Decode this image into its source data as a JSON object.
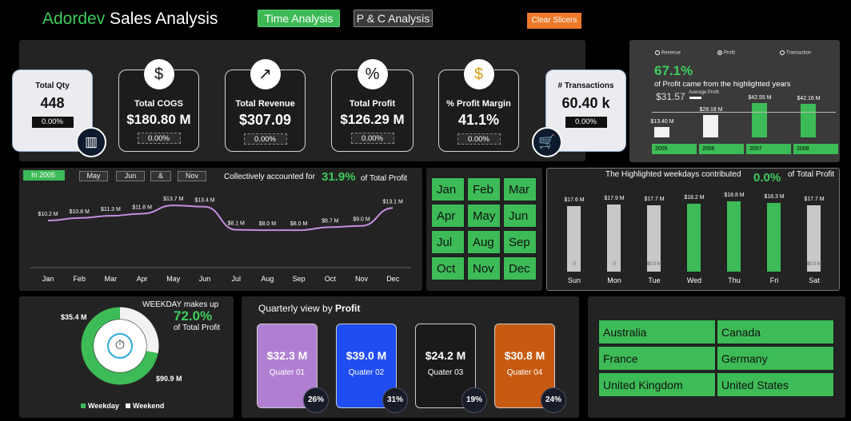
{
  "header": {
    "brand": "Adordev",
    "title": " Sales Analysis",
    "nav_time": "Time Analysis",
    "nav_pc": "P & C Analysis",
    "clear": "Clear Slicers"
  },
  "kpis": {
    "qty": {
      "label": "Total Qty",
      "value": "448",
      "pct": "0.00%"
    },
    "cogs": {
      "label": "Total COGS",
      "value": "$180.80 M",
      "pct": "0.00%"
    },
    "revenue": {
      "label": "Total Revenue",
      "value": "$307.09",
      "pct": "0.00%"
    },
    "profit": {
      "label": "Total Profit",
      "value": "$126.29 M",
      "pct": "0.00%"
    },
    "margin": {
      "label": "% Profit Margin",
      "value": "41.1%",
      "pct": "0.00%"
    },
    "transactions": {
      "label": "# Transactions",
      "value": "60.40 k",
      "pct": "0.00%"
    }
  },
  "yearly": {
    "options": [
      "Revenue",
      "Profit",
      "Transaction"
    ],
    "selected": "Profit",
    "headline": "67.1%",
    "subtitle": "of Profit came from the highlighted years",
    "avg_value": "$31.57",
    "avg_label": "Average Profit",
    "colors": {
      "highlight": "#3dbb57",
      "normal": "#f2f2f2"
    },
    "chart_data": {
      "type": "bar",
      "categories": [
        "2005",
        "2006",
        "2007",
        "2008"
      ],
      "values": [
        13.4,
        28.18,
        42.55,
        42.16
      ],
      "labels": [
        "$13.40 M",
        "$28.18 M",
        "$42.55 M",
        "$42.16 M"
      ],
      "highlighted": [
        false,
        false,
        true,
        true
      ],
      "reference_line": 31.57
    }
  },
  "monthly": {
    "year_chip": "In 2005",
    "chips": [
      "May",
      "Jun",
      "&",
      "Nov"
    ],
    "text_pre": "Collectively accounted for",
    "pct": "31.9%",
    "text_post": "of Total Profit",
    "chart_data": {
      "type": "line",
      "categories": [
        "Jan",
        "Feb",
        "Mar",
        "Apr",
        "May",
        "Jun",
        "Jul",
        "Aug",
        "Sep",
        "Oct",
        "Nov",
        "Dec"
      ],
      "values": [
        10.2,
        10.8,
        11.3,
        11.8,
        13.7,
        13.4,
        8.1,
        8.0,
        8.0,
        8.7,
        9.0,
        13.1
      ],
      "labels": [
        "$10.2 M",
        "$10.8 M",
        "$11.3 M",
        "$11.8 M",
        "$13.7 M",
        "$13.4 M",
        "$8.1 M",
        "$8.0 M",
        "$8.0 M",
        "$8.7 M",
        "$9.0 M",
        "$13.1 M"
      ],
      "color": "#c38fe0"
    }
  },
  "month_slicer": [
    "Jan",
    "Feb",
    "Mar",
    "Apr",
    "May",
    "Jun",
    "Jul",
    "Aug",
    "Sep",
    "Oct",
    "Nov",
    "Dec"
  ],
  "weekday": {
    "text_pre": "The Highlighted weekdays contributed",
    "pct": "0.0%",
    "text_post": "of Total Profit",
    "colors": {
      "highlight": "#3dbb57",
      "normal": "#c8c8c8"
    },
    "chart_data": {
      "type": "bar",
      "categories": [
        "Sun",
        "Mon",
        "Tue",
        "Wed",
        "Thu",
        "Fri",
        "Sat"
      ],
      "values": [
        17.6,
        17.9,
        17.7,
        18.2,
        18.8,
        18.3,
        17.7
      ],
      "labels": [
        "$17.6 M",
        "$17.9 M",
        "$17.7 M",
        "$18.2 M",
        "$18.8 M",
        "$18.3 M",
        "$17.7 M"
      ],
      "highlighted": [
        false,
        false,
        false,
        true,
        true,
        true,
        false
      ],
      "inner_labels": [
        "0",
        "0",
        "$0.0 M",
        "",
        "",
        "",
        "$0.0 M"
      ]
    }
  },
  "weekpart": {
    "title": "WEEKDAY makes up",
    "pct": "72.0%",
    "subtitle": "of Total Profit",
    "weekday_value": "$90.9 M",
    "weekend_value": "$35.4 M",
    "legend_weekday": "Weekday",
    "legend_weekend": "Weekend",
    "chart_data": {
      "type": "pie",
      "categories": [
        "Weekday",
        "Weekend"
      ],
      "values": [
        90.9,
        35.4
      ],
      "colors": [
        "#3dbb57",
        "#f2f2f2"
      ]
    }
  },
  "quarterly": {
    "title_pre": "Quarterly view by ",
    "title_metric": "Profit",
    "cards": [
      {
        "value": "$32.3 M",
        "label": "Quater 01",
        "pct": "26%",
        "color": "#b07fd2"
      },
      {
        "value": "$39.0 M",
        "label": "Quater 02",
        "pct": "31%",
        "color": "#1f4df2"
      },
      {
        "value": "$24.2 M",
        "label": "Quater 03",
        "pct": "19%",
        "color": "#1a1a1a"
      },
      {
        "value": "$30.8 M",
        "label": "Quater 04",
        "pct": "24%",
        "color": "#c75a10"
      }
    ]
  },
  "countries": [
    "Australia",
    "Canada",
    "France",
    "Germany",
    "United Kingdom",
    "United States"
  ]
}
